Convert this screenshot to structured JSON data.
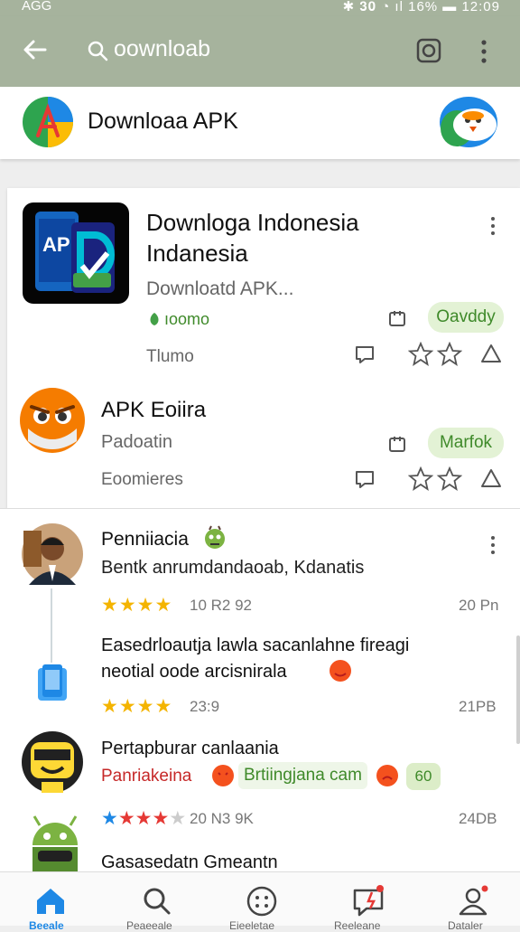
{
  "status": {
    "left": "AGG",
    "right": "✱ 𝟑𝟎 ◔ ıl 16% ▬ 12:09"
  },
  "appbar": {
    "query": "oownloab"
  },
  "filter": {
    "title": "Downloaa APK"
  },
  "app1": {
    "title_line1": "Downloga Indonesia",
    "title_line2": "Indanesia",
    "subtitle": "Downloatd APK...",
    "count": "ıoomo",
    "chip": "Oavddy",
    "meta": "Tlumo"
  },
  "app2": {
    "title": "APK Eoiira",
    "subtitle": "Padoatin",
    "chip": "Marfok",
    "meta": "Eoomieres"
  },
  "review1": {
    "name": "Penniiacia",
    "text": "Bentk anrumdandaoab, Kdanatis",
    "stars": "★★★★",
    "meta": "10 R2    92",
    "date": "20 Pn"
  },
  "review2": {
    "line1": "Easedrloautja lawla sacanlahne fireagi",
    "line2": "neotial oode arcisnirala",
    "stars": "★★★★",
    "meta": "23:9",
    "date": "21PB"
  },
  "review3": {
    "name": "Pertapburar canlaania",
    "tag1": "Panriakeina",
    "tag2": "Brtiingjana cam",
    "tag3": "60",
    "stars_full": "★★★",
    "stars_blue": "★",
    "stars_empty": "★",
    "meta": "20 N3    9K",
    "date": "24DB"
  },
  "review4": {
    "name": "Gasasedatn Gmeantn"
  },
  "nav": {
    "home": "Beeale",
    "search": "Peaeeale",
    "apps": "Eieeletae",
    "updates": "Reeleane",
    "profile": "Dataler"
  },
  "colors": {
    "appbar": "#a6b39d",
    "chip_bg": "#e3f2d5",
    "chip_text": "#3f8a2a",
    "star": "#f4b400",
    "nav_active": "#1e88e5"
  }
}
